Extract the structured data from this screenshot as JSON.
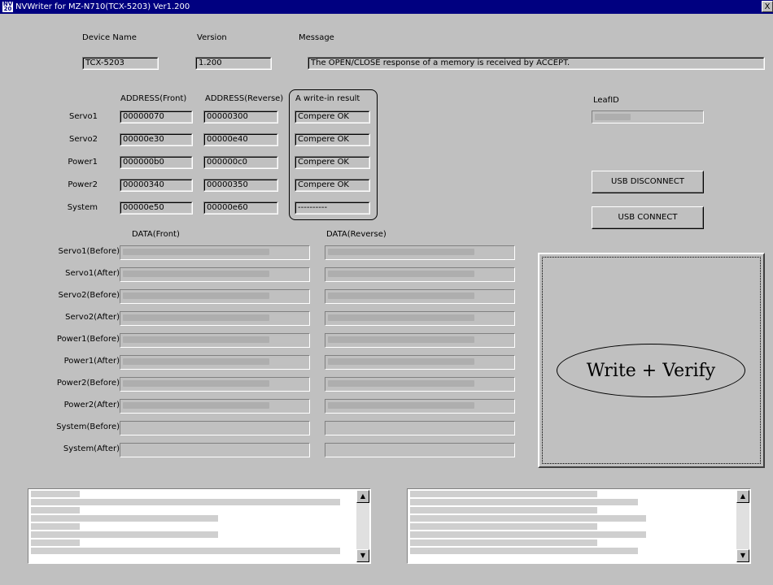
{
  "window": {
    "title": "NVWriter for MZ-N710(TCX-5203) Ver1.200",
    "close_glyph": "X",
    "icon_text": "NV\n20"
  },
  "header": {
    "device_name_label": "Device Name",
    "version_label": "Version",
    "message_label": "Message",
    "device_name_value": "TCX-5203",
    "version_value": "1.200",
    "message_value": "The OPEN/CLOSE response of a memory is received by ACCEPT."
  },
  "address_table": {
    "col_front": "ADDRESS(Front)",
    "col_reverse": "ADDRESS(Reverse)",
    "col_result": "A write-in result",
    "rows": [
      {
        "label": "Servo1",
        "front": "00000070",
        "reverse": "00000300",
        "result": "Compere OK"
      },
      {
        "label": "Servo2",
        "front": "00000e30",
        "reverse": "00000e40",
        "result": "Compere OK"
      },
      {
        "label": "Power1",
        "front": "000000b0",
        "reverse": "000000c0",
        "result": "Compere OK"
      },
      {
        "label": "Power2",
        "front": "00000340",
        "reverse": "00000350",
        "result": "Compere OK"
      },
      {
        "label": "System",
        "front": "00000e50",
        "reverse": "00000e60",
        "result": "----------"
      }
    ]
  },
  "leaf": {
    "label": "LeafID"
  },
  "buttons": {
    "usb_disconnect": "USB DISCONNECT",
    "usb_connect": "USB CONNECT",
    "write_verify": "Write + Verify"
  },
  "data_table": {
    "col_front": "DATA(Front)",
    "col_reverse": "DATA(Reverse)",
    "rows": [
      {
        "label": "Servo1(Before)"
      },
      {
        "label": "Servo1(After)"
      },
      {
        "label": "Servo2(Before)"
      },
      {
        "label": "Servo2(After)"
      },
      {
        "label": "Power1(Before)"
      },
      {
        "label": "Power1(After)"
      },
      {
        "label": "Power2(Before)"
      },
      {
        "label": "Power2(After)"
      },
      {
        "label": "System(Before)"
      },
      {
        "label": "System(After)"
      }
    ]
  },
  "scroll": {
    "up_glyph": "▲",
    "down_glyph": "▼"
  }
}
